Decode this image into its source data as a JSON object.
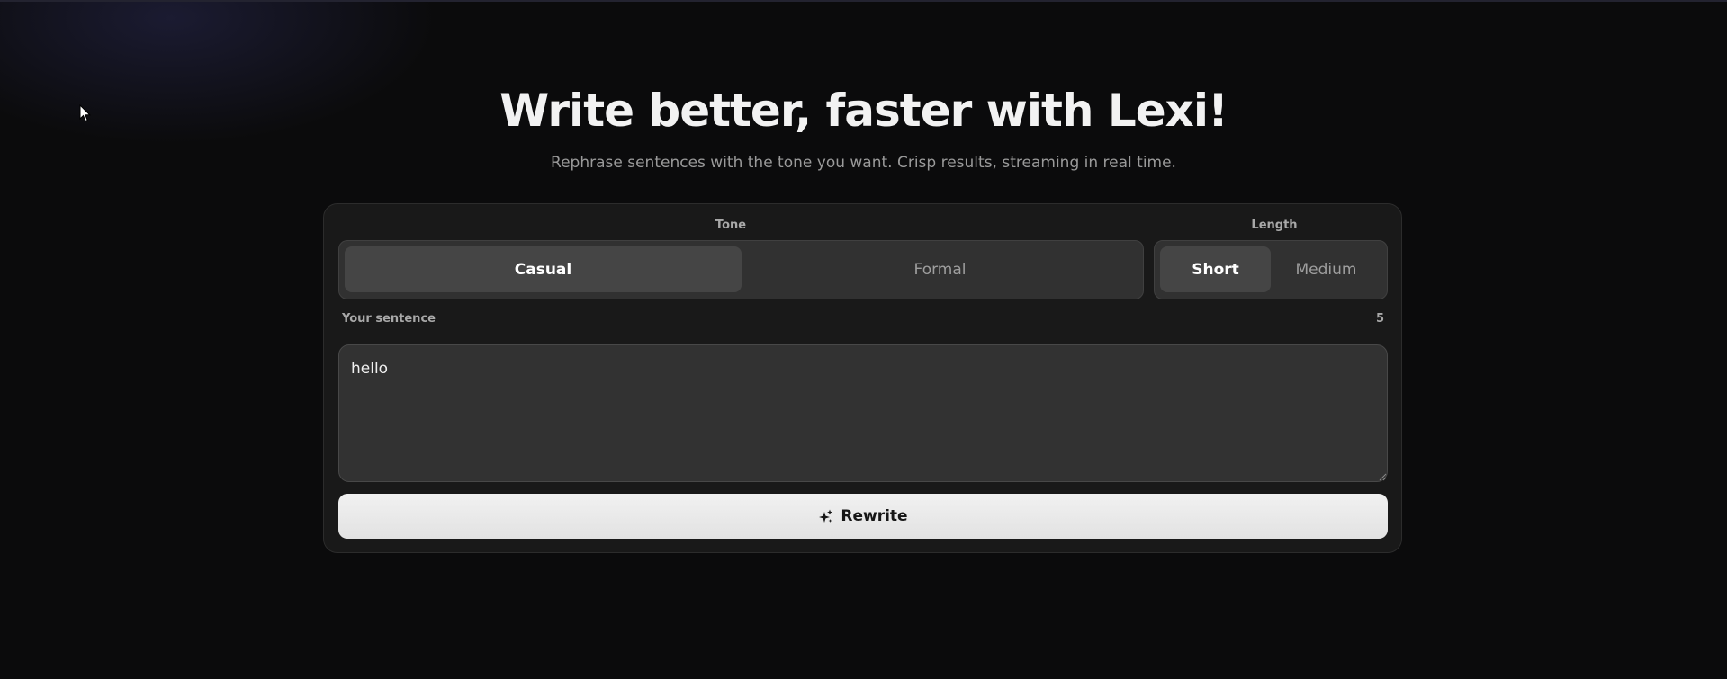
{
  "hero": {
    "title": "Write better, faster with Lexi!",
    "subtitle": "Rephrase sentences with the tone you want. Crisp results, streaming in real time."
  },
  "tone": {
    "label": "Tone",
    "options": [
      "Casual",
      "Formal"
    ],
    "selected": "Casual"
  },
  "length": {
    "label": "Length",
    "options": [
      "Short",
      "Medium"
    ],
    "selected": "Short"
  },
  "sentence": {
    "label": "Your sentence",
    "char_count": "5",
    "value": "hello"
  },
  "rewrite_button": {
    "label": "Rewrite",
    "icon": "sparkles-icon"
  },
  "colors": {
    "background": "#0b0b0c",
    "card": "#191919",
    "active_segment": "#454545",
    "button": "#e8e8e8"
  }
}
